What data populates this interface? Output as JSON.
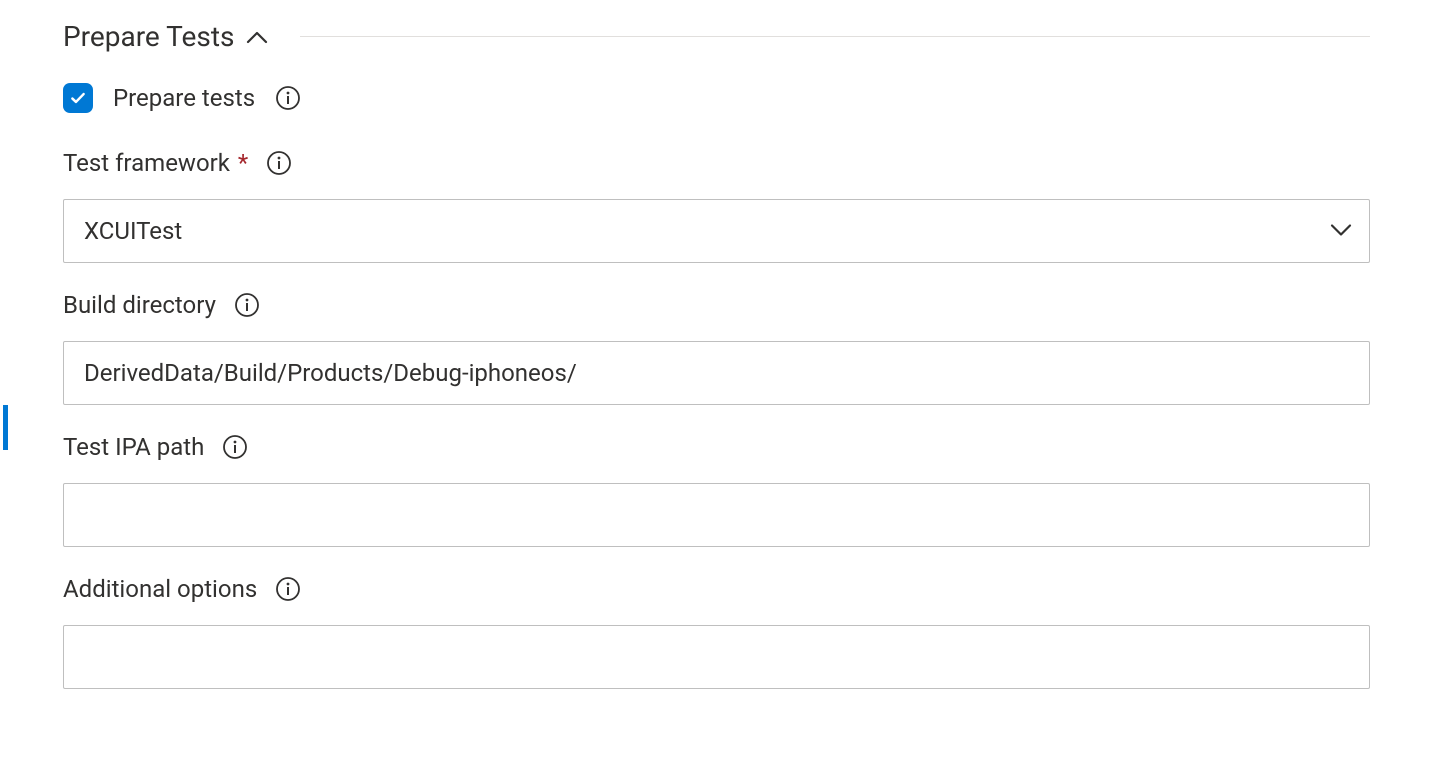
{
  "section": {
    "title": "Prepare Tests"
  },
  "fields": {
    "prepare_tests": {
      "label": "Prepare tests",
      "checked": true
    },
    "test_framework": {
      "label": "Test framework",
      "required": true,
      "value": "XCUITest"
    },
    "build_directory": {
      "label": "Build directory",
      "value": "DerivedData/Build/Products/Debug-iphoneos/"
    },
    "test_ipa_path": {
      "label": "Test IPA path",
      "value": ""
    },
    "additional_options": {
      "label": "Additional options",
      "value": ""
    }
  }
}
